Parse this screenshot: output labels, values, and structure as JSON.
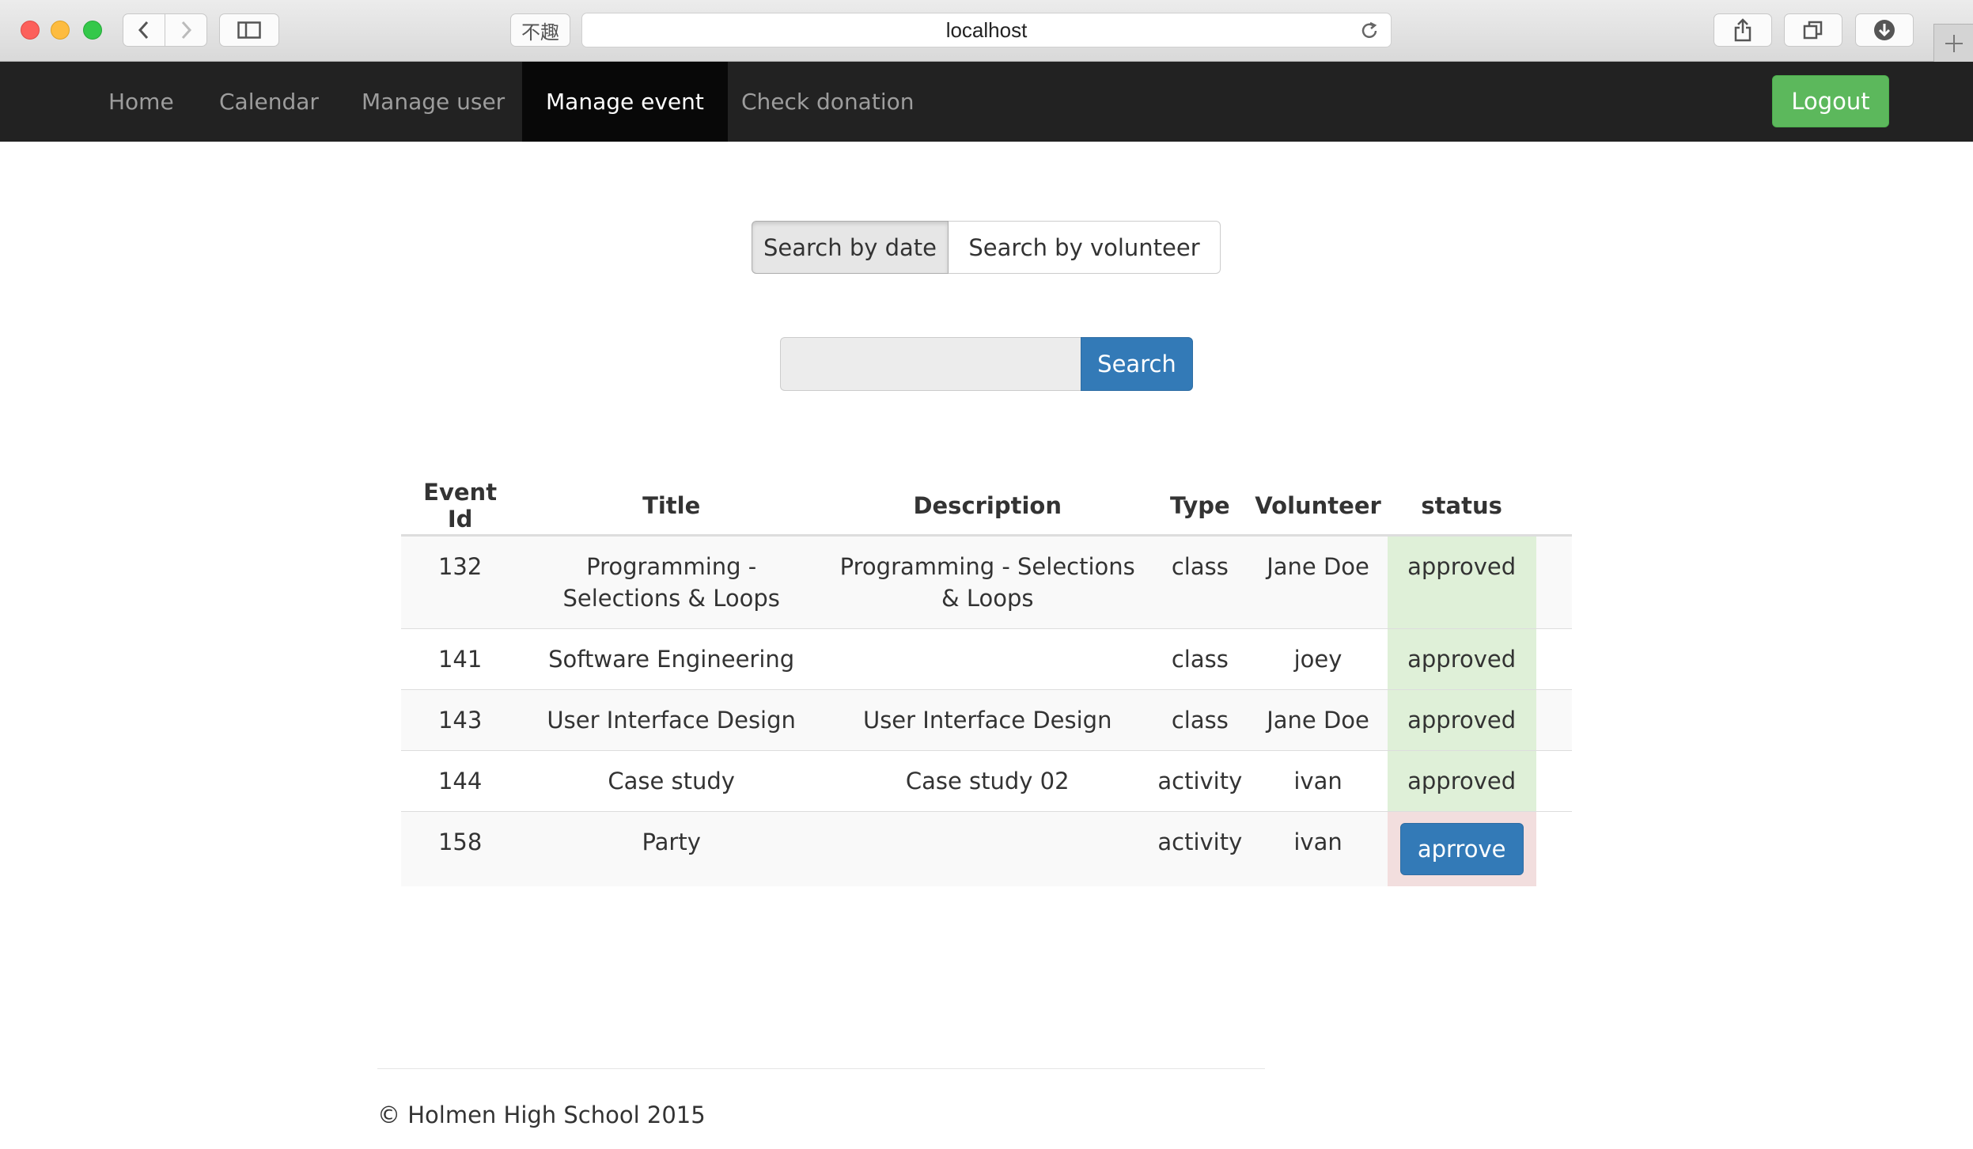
{
  "browser": {
    "url": "localhost",
    "reader_glyph": "不趣"
  },
  "nav": {
    "items": [
      {
        "label": "Home"
      },
      {
        "label": "Calendar"
      },
      {
        "label": "Manage user"
      },
      {
        "label": "Manage event"
      },
      {
        "label": "Check donation"
      }
    ],
    "active": "Manage event",
    "logout_label": "Logout"
  },
  "search_mode": {
    "options": [
      {
        "label": "Search by date"
      },
      {
        "label": "Search by volunteer"
      }
    ],
    "selected": "Search by date"
  },
  "search": {
    "value": "",
    "placeholder": "",
    "button_label": "Search"
  },
  "events_table": {
    "columns": [
      "Event Id",
      "Title",
      "Description",
      "Type",
      "Volunteer",
      "status"
    ],
    "rows": [
      {
        "id": "132",
        "title": "Programming - Selections & Loops",
        "description": "Programming - Selections & Loops",
        "type": "class",
        "volunteer": "Jane Doe",
        "status": "approved"
      },
      {
        "id": "141",
        "title": "Software Engineering",
        "description": "",
        "type": "class",
        "volunteer": "joey",
        "status": "approved"
      },
      {
        "id": "143",
        "title": "User Interface Design",
        "description": "User Interface Design",
        "type": "class",
        "volunteer": "Jane Doe",
        "status": "approved"
      },
      {
        "id": "144",
        "title": "Case study",
        "description": "Case study 02",
        "type": "activity",
        "volunteer": "ivan",
        "status": "approved"
      },
      {
        "id": "158",
        "title": "Party",
        "description": "",
        "type": "activity",
        "volunteer": "ivan",
        "status_button": "aprrove"
      }
    ]
  },
  "footer": {
    "copyright": "© Holmen High School 2015"
  },
  "colors": {
    "navbar_bg": "#222222",
    "logout_green": "#5cb85c",
    "primary_blue": "#337ab7",
    "approved_bg": "#dff0d8",
    "pending_bg": "#f2dede"
  }
}
